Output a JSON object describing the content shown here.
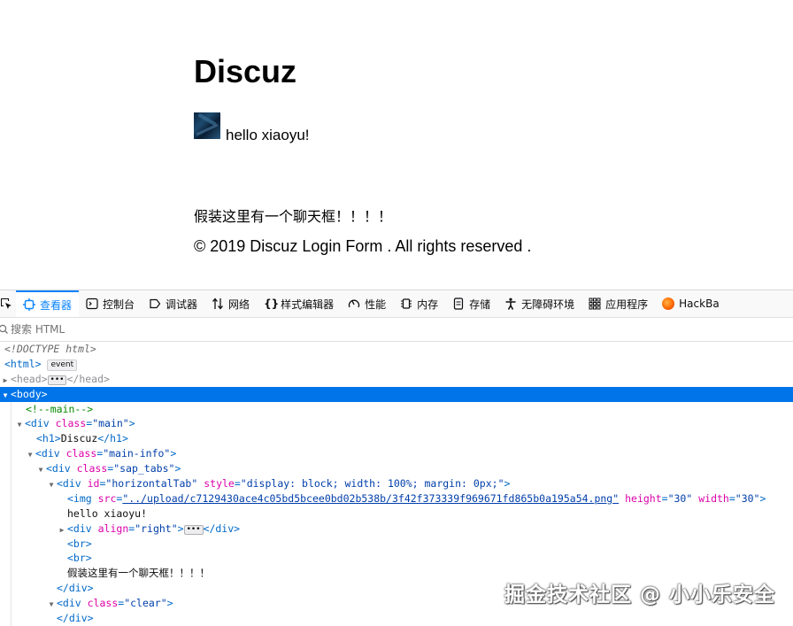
{
  "page": {
    "title": "Discuz",
    "greeting": "hello xiaoyu!",
    "chat_placeholder": "假装这里有一个聊天框！！！！",
    "footer": "© 2019 Discuz Login Form . All rights reserved ."
  },
  "devtools": {
    "tabs": [
      {
        "label": "查看器",
        "icon": "inspector-icon",
        "active": true
      },
      {
        "label": "控制台",
        "icon": "console-icon"
      },
      {
        "label": "调试器",
        "icon": "debugger-icon"
      },
      {
        "label": "网络",
        "icon": "network-icon"
      },
      {
        "label": "样式编辑器",
        "icon": "style-editor-icon"
      },
      {
        "label": "性能",
        "icon": "performance-icon"
      },
      {
        "label": "内存",
        "icon": "memory-icon"
      },
      {
        "label": "存储",
        "icon": "storage-icon"
      },
      {
        "label": "无障碍环境",
        "icon": "accessibility-icon"
      },
      {
        "label": "应用程序",
        "icon": "application-icon"
      },
      {
        "label": "HackBa",
        "icon": "hackbar-icon"
      }
    ],
    "search_placeholder": "搜索 HTML",
    "accent_color": "#0a84ff",
    "selection_color": "#0074e8",
    "tree": {
      "doctype": "<!DOCTYPE html>",
      "html_open": "<html>",
      "event_badge": "event",
      "head_open": "<head>",
      "head_close": "</head>",
      "body_open": "<body>",
      "comment": "<!--main-->",
      "div_main": {
        "open": "<div ",
        "attr": "class",
        "val": "\"main\"",
        "close": ">"
      },
      "h1": "<h1>Discuz</h1>",
      "div_main_info": {
        "attr": "class",
        "val": "\"main-info\""
      },
      "div_sap_tabs": {
        "attr": "class",
        "val": "\"sap_tabs\""
      },
      "div_horizontal": {
        "attr1": "id",
        "val1": "\"horizontalTab\"",
        "attr2": "style",
        "val2": "\"display: block; width: 100%; margin: 0px;\""
      },
      "img": {
        "attr1": "src",
        "val1": "\"../upload/c7129430ace4c05bd5bcee0bd02b538b/3f42f373339f969671fd865b0a195a54.png\"",
        "attr2": "height",
        "val2": "\"30\"",
        "attr3": "width",
        "val3": "\"30\""
      },
      "text_hello": "hello xiaoyu!",
      "div_align": {
        "attr": "align",
        "val": "\"right\""
      },
      "br1": "<br>",
      "br2": "<br>",
      "text_chat": "假装这里有一个聊天框！！！！",
      "div_close": "</div>",
      "div_clear": {
        "attr": "class",
        "val": "\"clear\""
      },
      "div_close2": "</div>"
    }
  },
  "watermark": "掘金技术社区 @ 小小乐安全"
}
